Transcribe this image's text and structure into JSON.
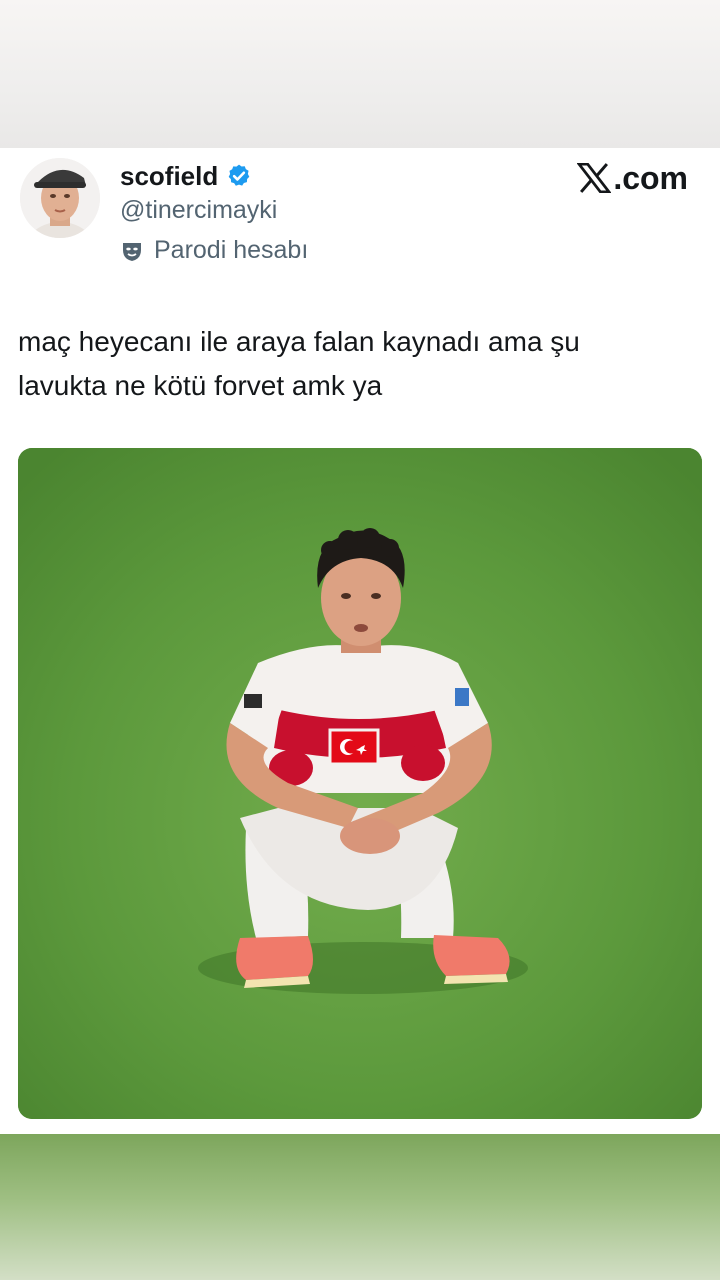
{
  "post": {
    "display_name": "scofield",
    "handle": "@tinercimayki",
    "parody_label": "Parodi hesabı",
    "site": ".com",
    "text_line_1": "maç heyecanı ile araya falan kaynadı ama şu",
    "text_line_2": "lavukta ne kötü forvet amk ya"
  },
  "icons": {
    "verified": "verified-badge-icon",
    "parody": "parody-mask-icon",
    "site_logo": "x-logo-icon"
  },
  "colors": {
    "verified_blue": "#1d9bf0",
    "text_primary": "#14171a",
    "text_secondary": "#536471",
    "pitch_green": "#5e9a3c",
    "jersey_red": "#c8102e"
  }
}
